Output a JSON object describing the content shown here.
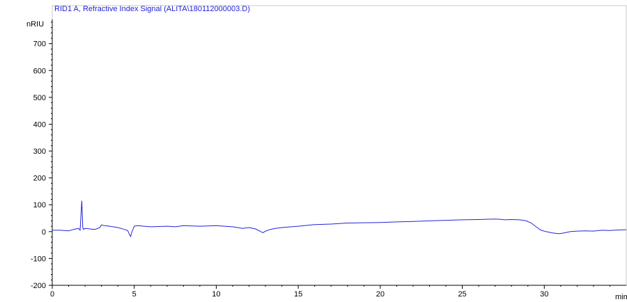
{
  "chart_data": {
    "type": "line",
    "title": "RID1 A, Refractive Index Signal (ALITA\\180112000003.D)",
    "ylabel": "nRIU",
    "xlabel": "min",
    "xlim": [
      0,
      35
    ],
    "ylim": [
      -200,
      790
    ],
    "x_ticks": [
      0,
      5,
      10,
      15,
      20,
      25,
      30
    ],
    "x_tick_labels": [
      "0",
      "5",
      "10",
      "15",
      "20",
      "25",
      "30"
    ],
    "y_ticks": [
      -200,
      -100,
      0,
      100,
      200,
      300,
      400,
      500,
      600,
      700
    ],
    "y_tick_labels": [
      "-200",
      "-100",
      "0",
      "100",
      "200",
      "300",
      "400",
      "500",
      "600",
      "700"
    ],
    "grid": false,
    "series": [
      {
        "color": "#2323d6",
        "x": [
          0,
          0.5,
          1.0,
          1.3,
          1.6,
          1.7,
          1.75,
          1.8,
          1.83,
          1.86,
          1.9,
          2.0,
          2.3,
          2.6,
          2.9,
          3.0,
          3.2,
          3.5,
          4.0,
          4.4,
          4.6,
          4.7,
          4.78,
          4.85,
          5.0,
          5.2,
          5.6,
          6.0,
          7.0,
          7.5,
          8.0,
          9.0,
          10.0,
          10.5,
          11.0,
          11.3,
          11.6,
          12.0,
          12.4,
          12.65,
          12.85,
          13.0,
          13.3,
          13.6,
          14.0,
          15.0,
          16.0,
          17.0,
          18.0,
          19.0,
          20.0,
          21.0,
          22.0,
          23.0,
          24.0,
          25.0,
          26.0,
          27.0,
          27.3,
          27.6,
          28.0,
          28.5,
          28.9,
          29.2,
          29.5,
          29.8,
          30.1,
          30.5,
          30.9,
          31.2,
          31.6,
          32.0,
          32.5,
          33.0,
          33.5,
          34.0,
          34.5,
          35.0
        ],
        "y": [
          5,
          5,
          3,
          8,
          12,
          5,
          60,
          115,
          70,
          15,
          8,
          12,
          10,
          8,
          15,
          25,
          22,
          20,
          15,
          8,
          4,
          -10,
          -18,
          -2,
          20,
          22,
          20,
          18,
          20,
          18,
          22,
          20,
          22,
          20,
          18,
          15,
          12,
          15,
          10,
          2,
          -4,
          2,
          8,
          12,
          15,
          20,
          26,
          28,
          32,
          33,
          34,
          36,
          38,
          40,
          42,
          44,
          45,
          47,
          46,
          44,
          45,
          44,
          40,
          32,
          18,
          5,
          0,
          -5,
          -8,
          -5,
          0,
          2,
          3,
          2,
          5,
          4,
          6,
          7
        ]
      }
    ]
  }
}
